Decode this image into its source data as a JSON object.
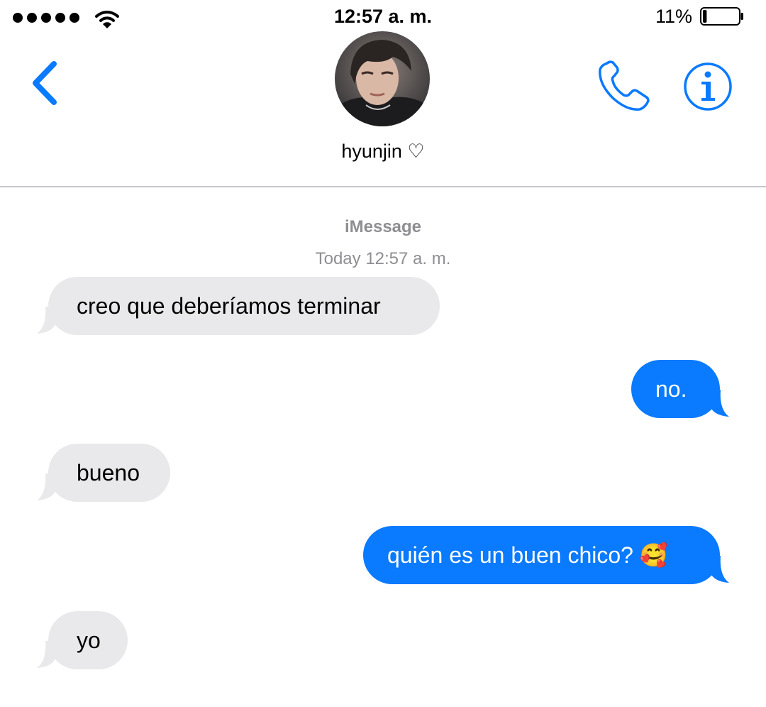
{
  "status_bar": {
    "time": "12:57 a. m.",
    "battery_percent": "11%",
    "battery_level": 0.11,
    "signal_dots": 5
  },
  "header": {
    "contact_name": "hyunjin ♡"
  },
  "thread": {
    "service": "iMessage",
    "timestamp": "Today 12:57 a. m.",
    "messages": [
      {
        "direction": "incoming",
        "text": "creo que deberíamos terminar"
      },
      {
        "direction": "outgoing",
        "text": "no."
      },
      {
        "direction": "incoming",
        "text": "bueno"
      },
      {
        "direction": "outgoing",
        "text": "quién es un buen chico? 🥰"
      },
      {
        "direction": "incoming",
        "text": "yo"
      }
    ]
  },
  "colors": {
    "accent": "#0a7aff",
    "incoming_bubble": "#e9e9eb",
    "meta_text": "#8e8e93"
  },
  "icons": [
    "signal-dots-icon",
    "wifi-icon",
    "battery-icon",
    "back-chevron-icon",
    "phone-icon",
    "info-icon"
  ]
}
